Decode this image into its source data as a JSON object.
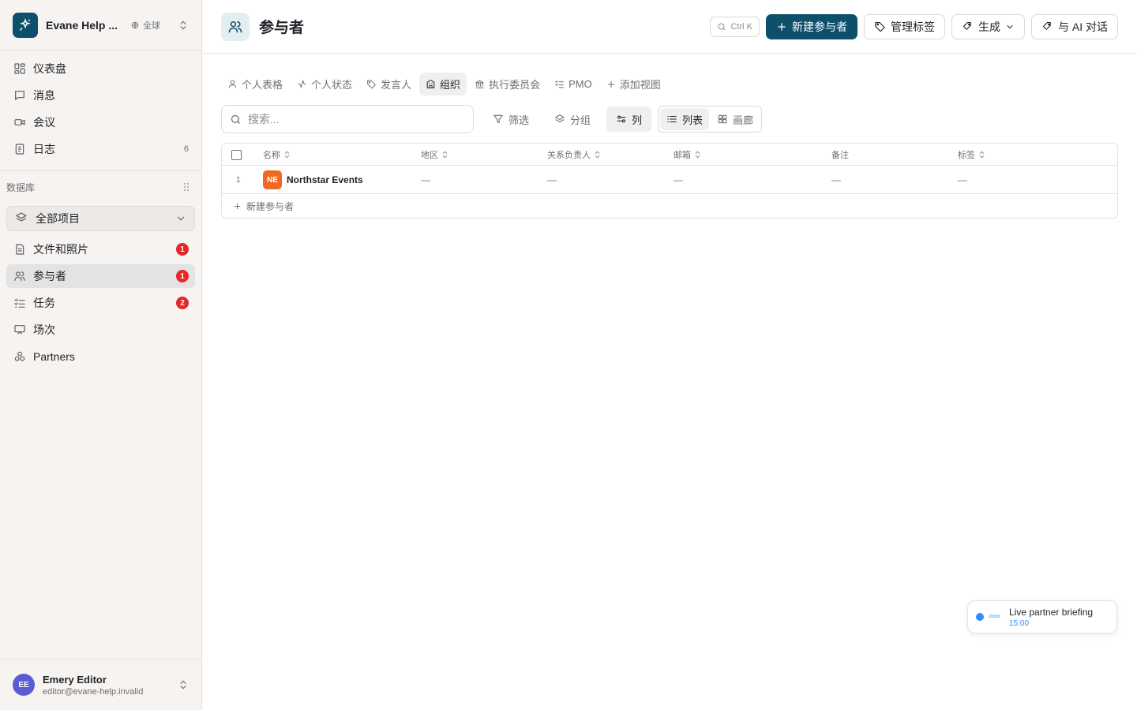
{
  "workspace": {
    "name": "Evane Help ...",
    "scope": "全球"
  },
  "nav": [
    {
      "label": "仪表盘",
      "icon": "dashboard-icon"
    },
    {
      "label": "消息",
      "icon": "message-icon"
    },
    {
      "label": "会议",
      "icon": "video-icon"
    },
    {
      "label": "日志",
      "icon": "log-icon",
      "count": "6"
    }
  ],
  "database": {
    "section_label": "数据库",
    "selected": "全部项目",
    "items": [
      {
        "label": "文件和照片",
        "badge": "1"
      },
      {
        "label": "参与者",
        "badge": "1"
      },
      {
        "label": "任务",
        "badge": "2"
      },
      {
        "label": "场次"
      },
      {
        "label": "Partners"
      }
    ]
  },
  "user": {
    "initials": "EE",
    "name": "Emery Editor",
    "email": "editor@evane-help.invalid"
  },
  "page": {
    "title": "参与者"
  },
  "toolbar": {
    "shortcut": "Ctrl K",
    "new_label": "新建参与者",
    "manage_tags": "管理标签",
    "generate": "生成",
    "ai_chat": "与 AI 对话"
  },
  "views": [
    "个人表格",
    "个人状态",
    "发言人",
    "组织",
    "执行委员会",
    "PMO",
    "添加视图"
  ],
  "filters": {
    "search_placeholder": "搜索...",
    "filter": "筛选",
    "group": "分组",
    "columns": "列",
    "list": "列表",
    "gallery": "画廊"
  },
  "table": {
    "columns": [
      "名称",
      "地区",
      "关系负责人",
      "邮箱",
      "备注",
      "标签"
    ],
    "rows": [
      {
        "index": "1",
        "initials": "NE",
        "name": "Northstar Events",
        "region": "—",
        "owner": "—",
        "email": "—",
        "note": "—",
        "tags": "—"
      }
    ],
    "add_row": "新建参与者"
  },
  "toast": {
    "logo": "zoom",
    "title": "Live partner briefing",
    "time": "15:00"
  },
  "colors": {
    "brand": "#0e4f6b",
    "badge": "#e5262a",
    "org": "#ee6a24",
    "zoom": "#2d8cff"
  }
}
